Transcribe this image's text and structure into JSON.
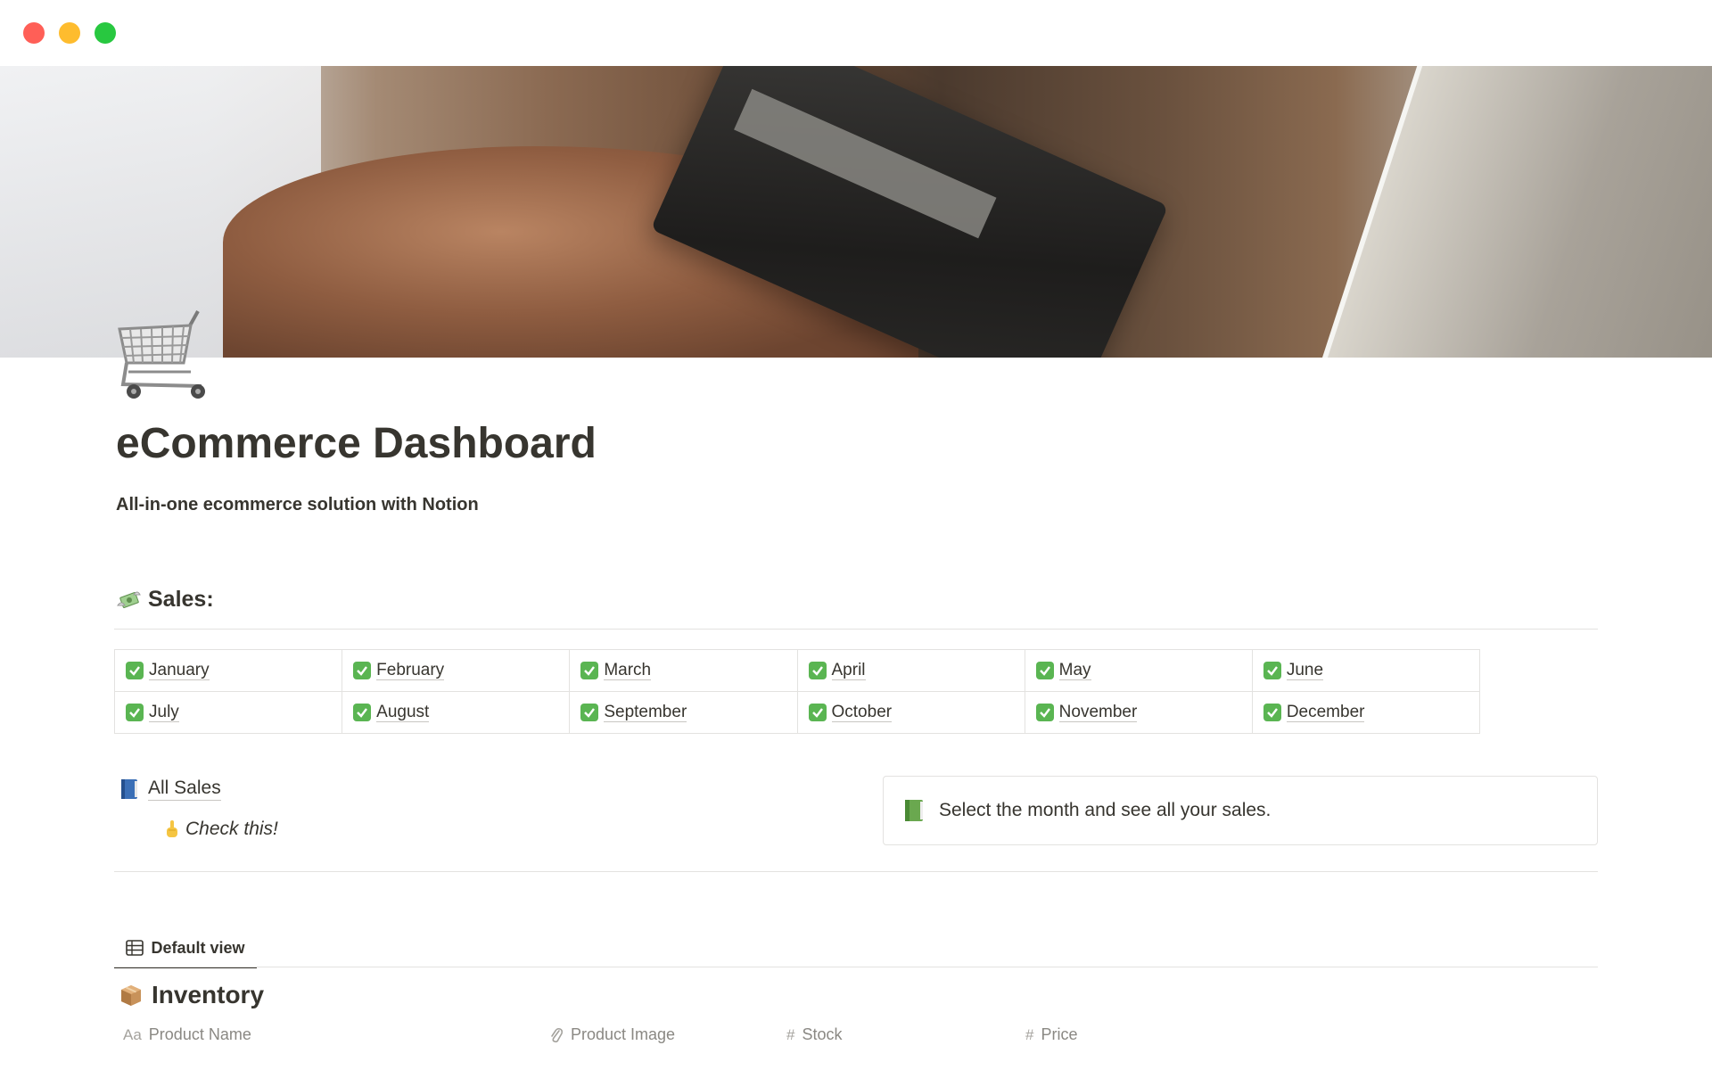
{
  "page": {
    "title": "eCommerce Dashboard",
    "subtitle": "All-in-one ecommerce solution with Notion"
  },
  "sales": {
    "heading": "Sales:",
    "months": [
      "January",
      "February",
      "March",
      "April",
      "May",
      "June",
      "July",
      "August",
      "September",
      "October",
      "November",
      "December"
    ]
  },
  "all_sales": {
    "label": "All Sales",
    "hint": "Check this!"
  },
  "callout": {
    "text": "Select the month and see all your sales."
  },
  "views": {
    "default_tab": "Default view"
  },
  "inventory": {
    "title": "Inventory",
    "columns": [
      {
        "icon": "Aa",
        "label": "Product Name"
      },
      {
        "icon": "paperclip",
        "label": "Product Image"
      },
      {
        "icon": "#",
        "label": "Stock"
      },
      {
        "icon": "#",
        "label": "Price"
      }
    ]
  },
  "colors": {
    "text": "#37352f",
    "check_green": "#5ab552",
    "divider": "#e3e2e0"
  }
}
